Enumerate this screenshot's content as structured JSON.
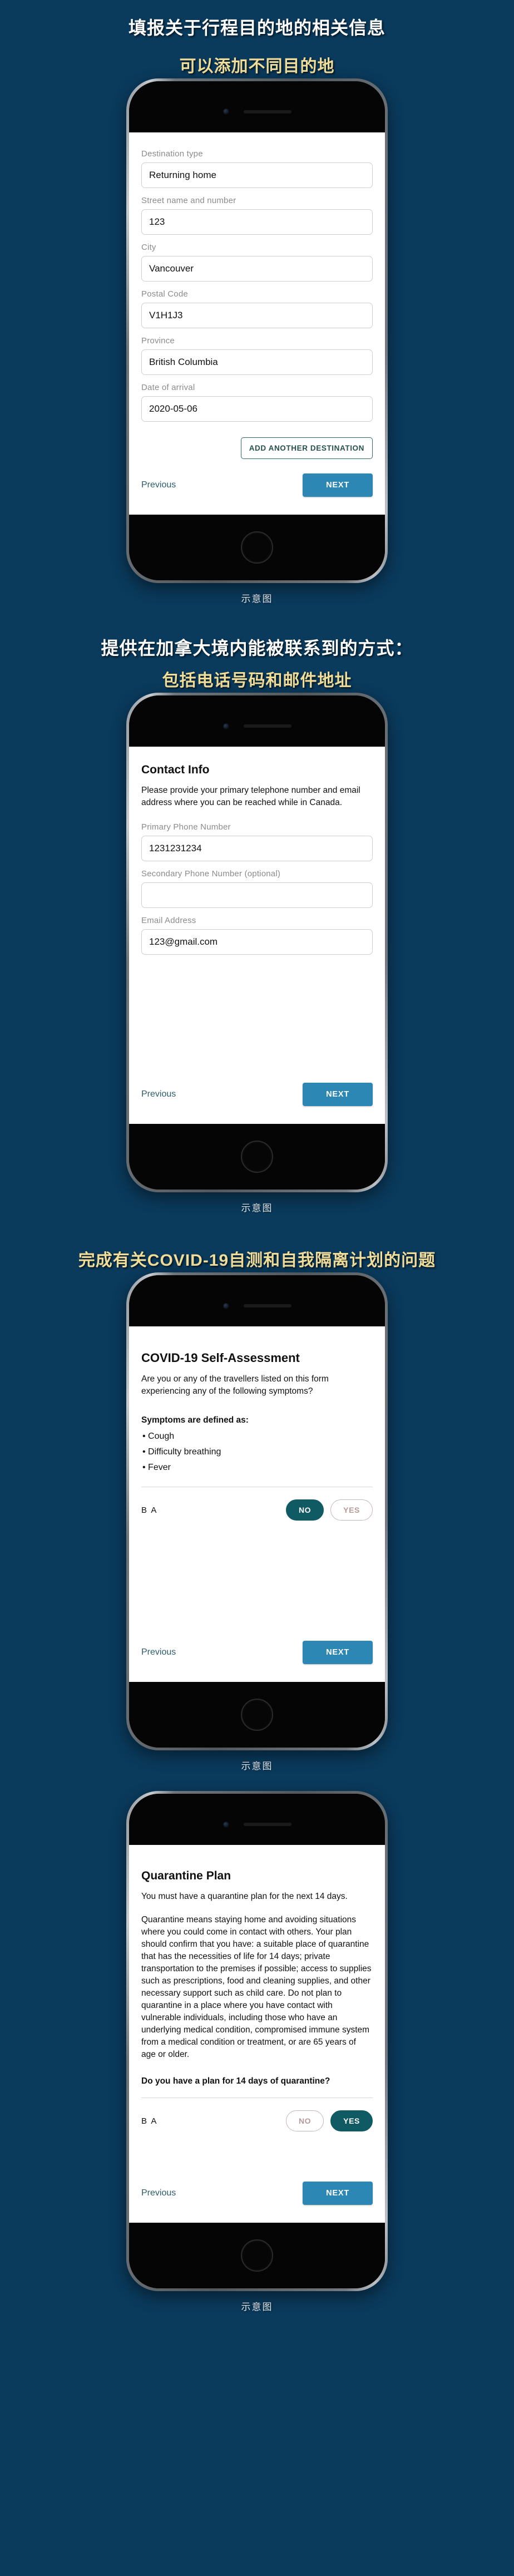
{
  "theme": {
    "background": "#0a3a5c",
    "heading_white": "#ffffff",
    "heading_gold": "#f1dd9a",
    "next_button": "#2c87b5",
    "toggle_selected": "#0f5a63",
    "outline_button": "#2b6b66"
  },
  "caption_label": "示意图",
  "sections": [
    {
      "heading_white": "填报关于行程目的地的相关信息",
      "heading_gold": "可以添加不同目的地"
    },
    {
      "heading_white": "提供在加拿大境内能被联系到的方式：",
      "heading_gold": "包括电话号码和邮件地址"
    },
    {
      "heading_white": "",
      "heading_gold": "完成有关COVID-19自测和自我隔离计划的问题"
    }
  ],
  "screen1": {
    "fields": [
      {
        "label": "Destination type",
        "value": "Returning home"
      },
      {
        "label": "Street name and number",
        "value": "123"
      },
      {
        "label": "City",
        "value": "Vancouver"
      },
      {
        "label": "Postal Code",
        "value": "V1H1J3"
      },
      {
        "label": "Province",
        "value": "British Columbia"
      },
      {
        "label": "Date of arrival",
        "value": "2020-05-06"
      }
    ],
    "add_destination_label": "ADD ANOTHER DESTINATION",
    "previous_label": "Previous",
    "next_label": "NEXT"
  },
  "screen2": {
    "title": "Contact Info",
    "intro": "Please provide your primary telephone number and email address where you can be reached while in Canada.",
    "fields": [
      {
        "label": "Primary Phone Number",
        "value": "1231231234"
      },
      {
        "label": "Secondary Phone Number (optional)",
        "value": ""
      },
      {
        "label": "Email Address",
        "value": "123@gmail.com"
      }
    ],
    "previous_label": "Previous",
    "next_label": "NEXT"
  },
  "screen3": {
    "title": "COVID-19 Self-Assessment",
    "question": "Are you or any of the travellers listed on this form experiencing any of the following symptoms?",
    "symptoms_heading": "Symptoms are defined as:",
    "symptoms": [
      "Cough",
      "Difficulty breathing",
      "Fever"
    ],
    "initials": "B A",
    "no_label": "NO",
    "yes_label": "YES",
    "selected": "NO",
    "previous_label": "Previous",
    "next_label": "NEXT"
  },
  "screen4": {
    "title": "Quarantine Plan",
    "paragraph1": "You must have a quarantine plan for the next 14 days.",
    "paragraph2": "Quarantine means staying home and avoiding situations where you could come in contact with others. Your plan should confirm that you have: a suitable place of quarantine that has the necessities of life for 14 days; private transportation to the premises if possible; access to supplies such as prescriptions, food and cleaning supplies, and other necessary support such as child care. Do not plan to quarantine in a place where you have contact with vulnerable individuals, including those who have an underlying medical condition, compromised immune system from a medical condition or treatment, or are 65 years of age or older.",
    "question": "Do you have a plan for 14 days of quarantine?",
    "initials": "B A",
    "no_label": "NO",
    "yes_label": "YES",
    "selected": "YES",
    "previous_label": "Previous",
    "next_label": "NEXT"
  }
}
